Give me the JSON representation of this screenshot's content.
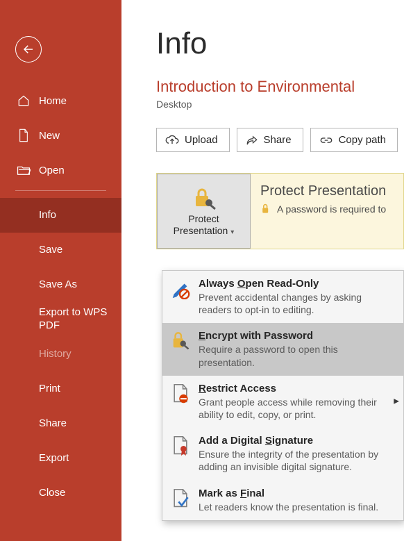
{
  "sidebar": {
    "top": [
      {
        "label": "Home"
      },
      {
        "label": "New"
      },
      {
        "label": "Open"
      }
    ],
    "sub": [
      {
        "label": "Info"
      },
      {
        "label": "Save"
      },
      {
        "label": "Save As"
      },
      {
        "label": "Export to WPS PDF"
      },
      {
        "label": "History"
      },
      {
        "label": "Print"
      },
      {
        "label": "Share"
      },
      {
        "label": "Export"
      },
      {
        "label": "Close"
      }
    ]
  },
  "main": {
    "page_title": "Info",
    "doc_title": "Introduction to Environmental ",
    "doc_path": "Desktop"
  },
  "toolbar": {
    "upload": "Upload",
    "share": "Share",
    "copy_path": "Copy path"
  },
  "protect": {
    "button_line1": "Protect",
    "button_line2": "Presentation",
    "header": "Protect Presentation",
    "subtext": "A password is required to "
  },
  "dropdown": {
    "items": [
      {
        "title_pre": "Always ",
        "title_u": "O",
        "title_post": "pen Read-Only",
        "desc": "Prevent accidental changes by asking readers to opt-in to editing."
      },
      {
        "title_pre": "",
        "title_u": "E",
        "title_post": "ncrypt with Password",
        "desc": "Require a password to open this presentation."
      },
      {
        "title_pre": "",
        "title_u": "R",
        "title_post": "estrict Access",
        "desc": "Grant people access while removing their ability to edit, copy, or print."
      },
      {
        "title_pre": "Add a Digital ",
        "title_u": "S",
        "title_post": "ignature",
        "desc": "Ensure the integrity of the presentation by adding an invisible digital signature."
      },
      {
        "title_pre": "Mark as ",
        "title_u": "F",
        "title_post": "inal",
        "desc": "Let readers know the presentation is final."
      }
    ]
  }
}
